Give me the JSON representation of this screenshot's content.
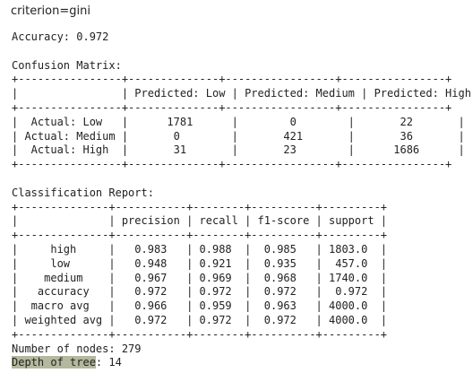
{
  "heading": "criterion=gini",
  "accuracy_line": "Accuracy: 0.972",
  "confusion": {
    "title": "Confusion Matrix:",
    "lines": [
      "+----------------+--------------+-----------------+----------------+",
      "|                | Predicted: Low | Predicted: Medium | Predicted: High |",
      "+----------------+--------------+-----------------+----------------+",
      "|  Actual: Low   |      1781      |        0        |       22       |",
      "| Actual: Medium |       0        |       421       |       36       |",
      "|  Actual: High  |       31       |       23        |      1686      |",
      "+----------------+--------------+-----------------+----------------+"
    ]
  },
  "report": {
    "title": "Classification Report:",
    "lines": [
      "+--------------+-----------+--------+----------+---------+",
      "|              | precision | recall | f1-score | support |",
      "+--------------+-----------+--------+----------+---------+",
      "|     high     |   0.983   | 0.988  |  0.985   | 1803.0  |",
      "|     low      |   0.948   | 0.921  |  0.935   |  457.0  |",
      "|    medium    |   0.967   | 0.969  |  0.968   | 1740.0  |",
      "|   accuracy   |   0.972   | 0.972  |  0.972   |  0.972  |",
      "|  macro avg   |   0.966   | 0.959  |  0.963   | 4000.0  |",
      "| weighted avg |   0.972   | 0.972  |  0.972   | 4000.0  |",
      "+--------------+-----------+--------+----------+---------+"
    ]
  },
  "nodes_line": "Number of nodes: 279",
  "depth": {
    "label": "Depth of tree",
    "value": ": 14"
  },
  "colors": {
    "highlight": "#b4b89c"
  }
}
